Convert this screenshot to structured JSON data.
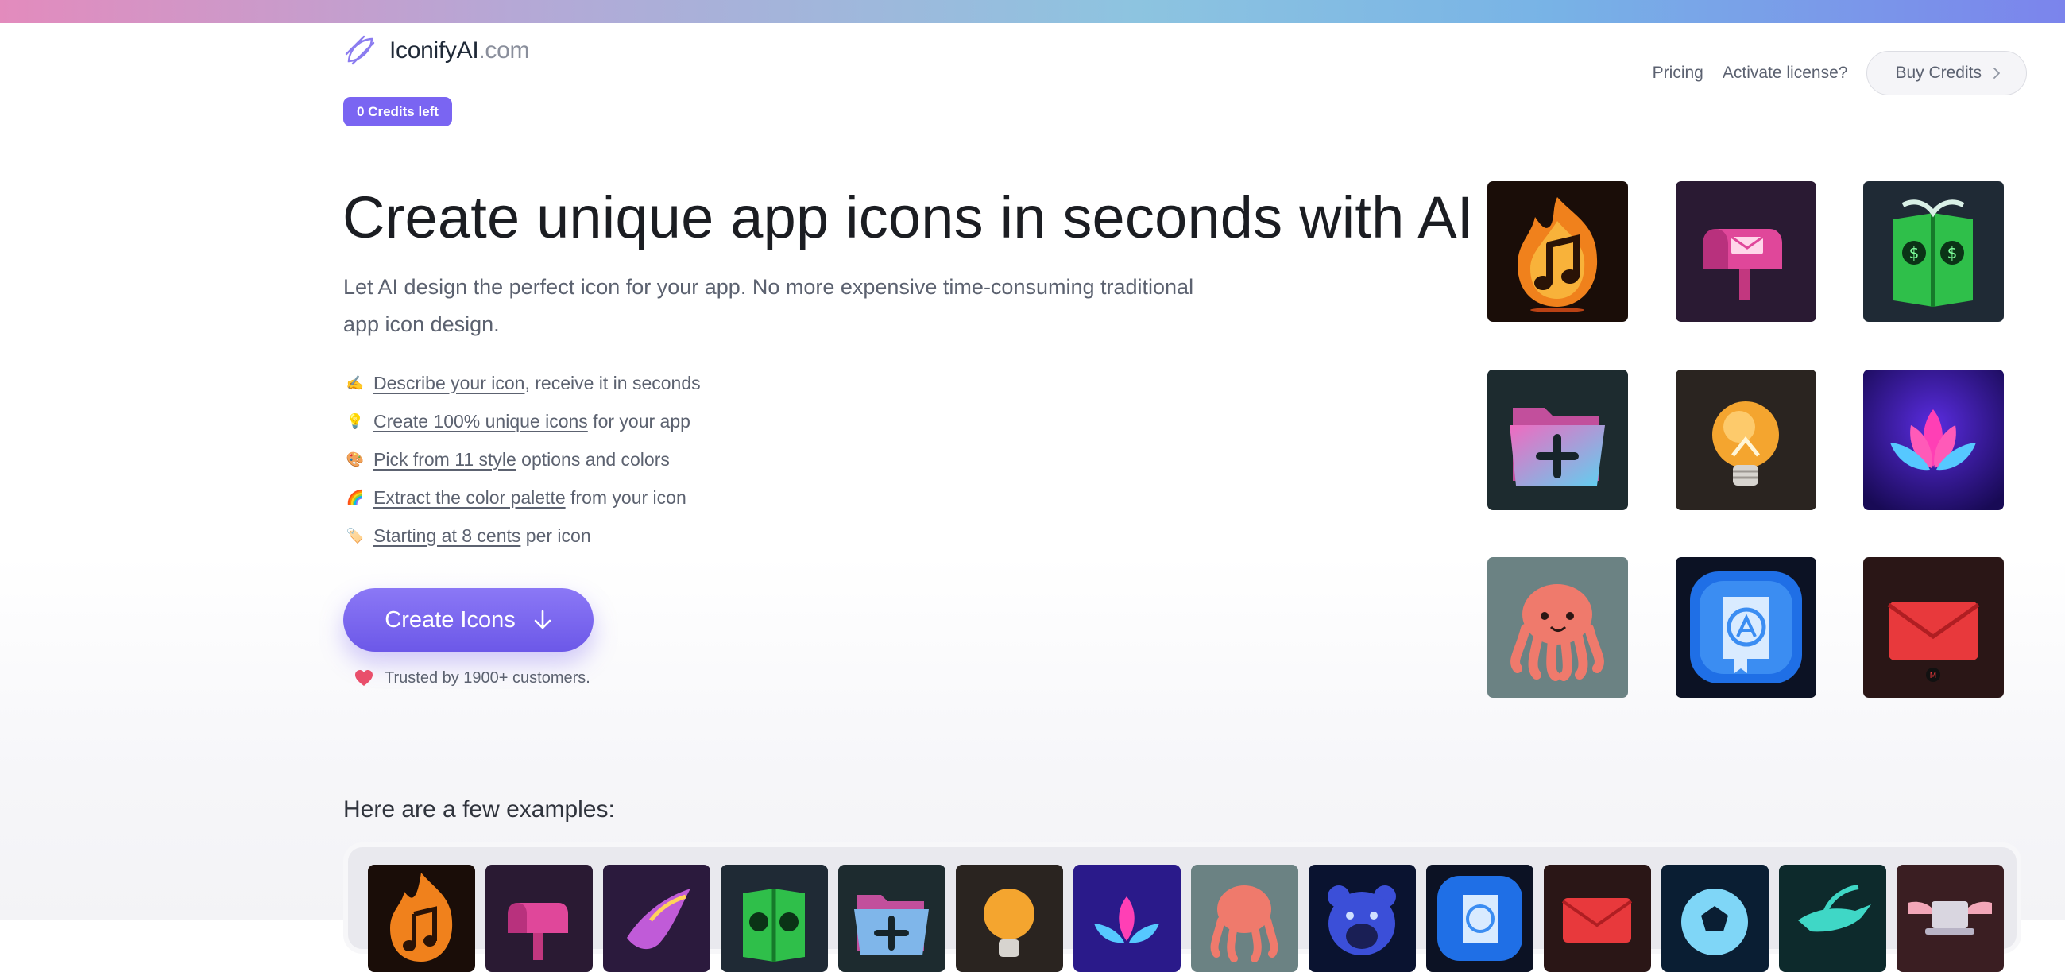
{
  "header": {
    "logo_name": "IconifyAI",
    "logo_tld": ".com",
    "credits_badge": "0 Credits left",
    "nav": {
      "pricing": "Pricing",
      "activate": "Activate license?",
      "buy_credits": "Buy Credits"
    }
  },
  "hero": {
    "title": "Create unique app icons in seconds with AI",
    "subtitle": "Let AI design the perfect icon for your app. No more expensive time-consuming traditional app icon design.",
    "features": [
      {
        "emoji": "✍️",
        "icon": "writing-hand-icon",
        "link": "Describe your icon",
        "rest": ", receive it in seconds"
      },
      {
        "emoji": "💡",
        "icon": "light-bulb-icon",
        "link": "Create 100% unique icons",
        "rest": " for your app"
      },
      {
        "emoji": "🎨",
        "icon": "palette-icon",
        "link": "Pick from 11 style",
        "rest": " options and colors"
      },
      {
        "emoji": "🌈",
        "icon": "rainbow-icon",
        "link": "Extract the color palette",
        "rest": " from your icon"
      },
      {
        "emoji": "🏷️",
        "icon": "price-tag-icon",
        "link": "Starting at 8 cents",
        "rest": " per icon"
      }
    ],
    "cta_label": "Create Icons",
    "trusted_text": "Trusted by 1900+ customers."
  },
  "icon_grid": [
    {
      "name": "fire-music-icon",
      "bg": "#1a0d08"
    },
    {
      "name": "mailbox-icon",
      "bg": "#2a1a33"
    },
    {
      "name": "money-book-icon",
      "bg": "#1f2a35"
    },
    {
      "name": "folder-plus-icon",
      "bg": "#1d2b2f"
    },
    {
      "name": "light-bulb-icon",
      "bg": "#2a2420"
    },
    {
      "name": "lotus-icon",
      "bg": "#2a1a8a"
    },
    {
      "name": "octopus-icon",
      "bg": "#6b8283"
    },
    {
      "name": "app-store-book-icon",
      "bg": "#0c1224"
    },
    {
      "name": "envelope-icon",
      "bg": "#2a1616"
    }
  ],
  "examples": {
    "title": "Here are a few examples:",
    "items": [
      {
        "name": "fire-music-icon",
        "bg": "#1a0d08"
      },
      {
        "name": "mailbox-icon",
        "bg": "#2a1a33"
      },
      {
        "name": "bird-icon",
        "bg": "#2b1a3d"
      },
      {
        "name": "money-book-icon",
        "bg": "#1f2a35"
      },
      {
        "name": "folder-plus-icon",
        "bg": "#1d2b2f"
      },
      {
        "name": "light-bulb-icon",
        "bg": "#2a2420"
      },
      {
        "name": "lotus-icon",
        "bg": "#2a1a8a"
      },
      {
        "name": "octopus-icon",
        "bg": "#6b8283"
      },
      {
        "name": "bear-icon",
        "bg": "#0a1330"
      },
      {
        "name": "app-store-book-icon",
        "bg": "#0c1224"
      },
      {
        "name": "envelope-icon",
        "bg": "#2a1616"
      },
      {
        "name": "soccer-ball-icon",
        "bg": "#0a1e33"
      },
      {
        "name": "hummingbird-icon",
        "bg": "#0d2a2c"
      },
      {
        "name": "winged-laptop-icon",
        "bg": "#3a1e22"
      }
    ]
  },
  "colors": {
    "accent": "#7a65f2",
    "heart": "#e94f6b"
  }
}
